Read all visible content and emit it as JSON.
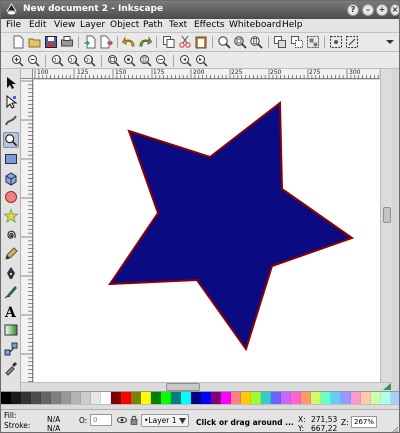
{
  "window": {
    "title": "New document 2 - Inkscape"
  },
  "menubar": {
    "items": [
      "File",
      "Edit",
      "View",
      "Layer",
      "Object",
      "Path",
      "Text",
      "Effects",
      "Whiteboard",
      "Help"
    ]
  },
  "ruler": {
    "top_ticks": [
      "100",
      "125",
      "150",
      "175",
      "200",
      "225",
      "250",
      "275",
      "300"
    ]
  },
  "star": {
    "fill": "#0a0a82",
    "stroke": "#8b0000"
  },
  "palette": {
    "colors": [
      "#000000",
      "#1a1a1a",
      "#333333",
      "#4d4d4d",
      "#666666",
      "#808080",
      "#999999",
      "#b3b3b3",
      "#cccccc",
      "#e6e6e6",
      "#ffffff",
      "#800000",
      "#ff0000",
      "#808000",
      "#ffff00",
      "#008000",
      "#00ff00",
      "#008080",
      "#00ffff",
      "#000080",
      "#0000ff",
      "#800080",
      "#ff00ff",
      "#ff8080",
      "#ffcc00",
      "#99ff33",
      "#33cccc",
      "#6666ff",
      "#cc66ff",
      "#ff66cc",
      "#ff9966",
      "#ccff66",
      "#66ffcc",
      "#66ccff",
      "#9999ff",
      "#ff99cc",
      "#ffccaa",
      "#ccffaa",
      "#aaffee",
      "#aaccff"
    ]
  },
  "status": {
    "fill_label": "Fill:",
    "stroke_label": "Stroke:",
    "fill_value": "N/A",
    "stroke_value": "N/A",
    "opacity_label": "O:",
    "opacity_value": "0",
    "layer_name": "•Layer 1",
    "message_click": "Click",
    "message_rest": " or drag around ...",
    "x_label": "X:",
    "y_label": "Y:",
    "x_value": "271,53",
    "y_value": "667,22",
    "zoom_label": "Z:",
    "zoom_value": "267%"
  }
}
